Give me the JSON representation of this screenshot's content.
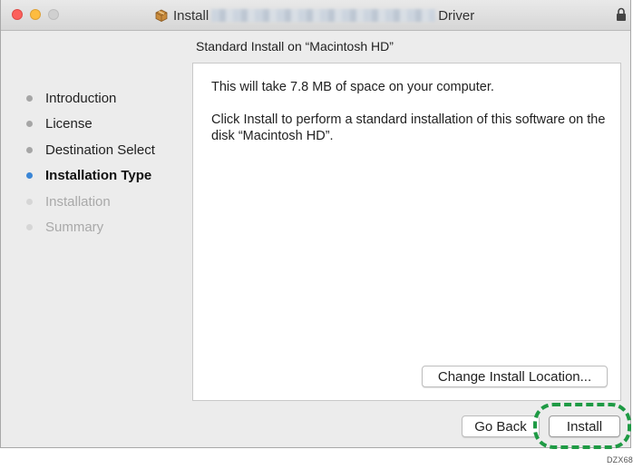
{
  "window": {
    "title_prefix": "Install",
    "title_suffix": "Driver",
    "subheading": "Standard Install on “Macintosh HD”"
  },
  "sidebar": {
    "steps": [
      {
        "label": "Introduction",
        "state": "done"
      },
      {
        "label": "License",
        "state": "done"
      },
      {
        "label": "Destination Select",
        "state": "done"
      },
      {
        "label": "Installation Type",
        "state": "active"
      },
      {
        "label": "Installation",
        "state": "future"
      },
      {
        "label": "Summary",
        "state": "future"
      }
    ]
  },
  "content": {
    "space_text": "This will take 7.8 MB of space on your computer.",
    "instructions_text": "Click Install to perform a standard installation of this software on the disk “Macintosh HD”."
  },
  "buttons": {
    "change_location": "Change Install Location...",
    "go_back": "Go Back",
    "install": "Install"
  },
  "figure_code": "DZX68",
  "colors": {
    "active_step": "#3b86d6",
    "highlight": "#1e9a44",
    "close": "#fc605c",
    "minimize": "#fdbc40"
  }
}
